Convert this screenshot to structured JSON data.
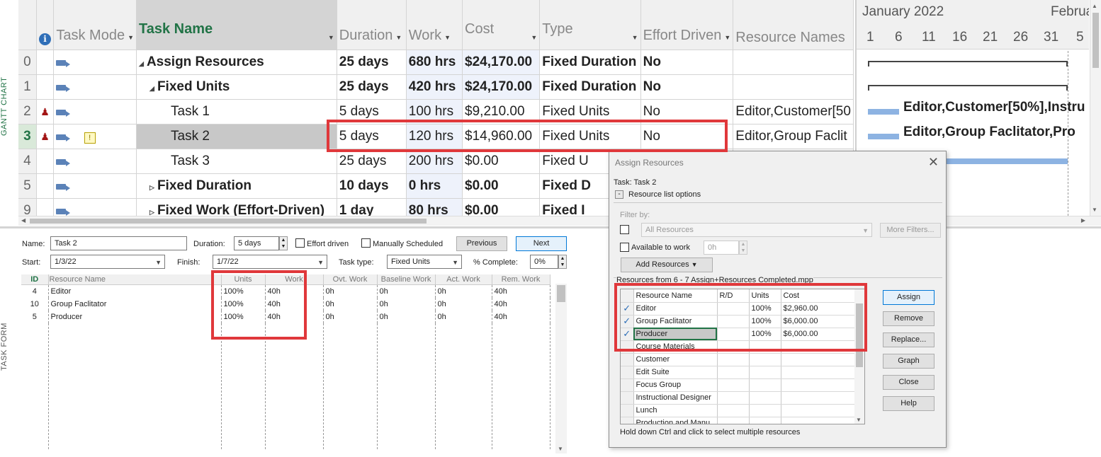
{
  "side_labels": {
    "gantt": "GANTT CHART",
    "form": "TASK FORM"
  },
  "gantt": {
    "headers": {
      "info": "i",
      "task_mode": "Task Mode",
      "task_name": "Task Name",
      "duration": "Duration",
      "work": "Work",
      "cost": "Cost",
      "type": "Type",
      "effort_driven": "Effort Driven",
      "resource_names": "Resource Names"
    },
    "rows": [
      {
        "id": "0",
        "indicator": "",
        "name": "Assign Resources",
        "outline": "◢",
        "duration": "25 days",
        "work": "680 hrs",
        "cost": "$24,170.00",
        "type": "Fixed Duration",
        "effort": "No",
        "resources": ""
      },
      {
        "id": "1",
        "indicator": "",
        "name": "Fixed Units",
        "outline": "◢",
        "duration": "25 days",
        "work": "420 hrs",
        "cost": "$24,170.00",
        "type": "Fixed Duration",
        "effort": "No",
        "resources": ""
      },
      {
        "id": "2",
        "indicator": "person",
        "name": "Task 1",
        "outline": "",
        "duration": "5 days",
        "work": "100 hrs",
        "cost": "$9,210.00",
        "type": "Fixed Units",
        "effort": "No",
        "resources": "Editor,Customer[50"
      },
      {
        "id": "3",
        "indicator": "person",
        "name": "Task 2",
        "outline": "",
        "duration": "5 days",
        "work": "120 hrs",
        "cost": "$14,960.00",
        "type": "Fixed Units",
        "effort": "No",
        "resources": "Editor,Group Faclit"
      },
      {
        "id": "4",
        "indicator": "",
        "name": "Task 3",
        "outline": "",
        "duration": "25 days",
        "work": "200 hrs",
        "cost": "$0.00",
        "type": "Fixed U",
        "effort": "",
        "resources": ""
      },
      {
        "id": "5",
        "indicator": "",
        "name": "Fixed Duration",
        "outline": "▷",
        "duration": "10 days",
        "work": "0 hrs",
        "cost": "$0.00",
        "type": "Fixed D",
        "effort": "",
        "resources": ""
      },
      {
        "id": "9",
        "indicator": "",
        "name": "Fixed Work (Effort-Driven)",
        "outline": "▷",
        "duration": "1 day",
        "work": "80 hrs",
        "cost": "$0.00",
        "type": "Fixed I",
        "effort": "",
        "resources": ""
      }
    ]
  },
  "chart": {
    "month1": "January 2022",
    "month2": "Februa",
    "days": [
      "1",
      "6",
      "11",
      "16",
      "21",
      "26",
      "31",
      "5"
    ],
    "bar_labels": {
      "task1": "Editor,Customer[50%],Instru",
      "task2": "Editor,Group Faclitator,Pro"
    }
  },
  "task_form": {
    "name_label": "Name:",
    "name_value": "Task 2",
    "duration_label": "Duration:",
    "duration_value": "5 days",
    "effort_driven_label": "Effort driven",
    "manually_scheduled_label": "Manually Scheduled",
    "previous_label": "Previous",
    "next_label": "Next",
    "start_label": "Start:",
    "start_value": "1/3/22",
    "finish_label": "Finish:",
    "finish_value": "1/7/22",
    "task_type_label": "Task type:",
    "task_type_value": "Fixed Units",
    "pct_complete_label": "% Complete:",
    "pct_complete_value": "0%",
    "columns": [
      "ID",
      "Resource Name",
      "Units",
      "Work",
      "Ovt. Work",
      "Baseline Work",
      "Act. Work",
      "Rem. Work"
    ],
    "resources": [
      {
        "id": "4",
        "name": "Editor",
        "units": "100%",
        "work": "40h",
        "ovt": "0h",
        "baseline": "0h",
        "act": "0h",
        "rem": "40h"
      },
      {
        "id": "10",
        "name": "Group Faclitator",
        "units": "100%",
        "work": "40h",
        "ovt": "0h",
        "baseline": "0h",
        "act": "0h",
        "rem": "40h"
      },
      {
        "id": "5",
        "name": "Producer",
        "units": "100%",
        "work": "40h",
        "ovt": "0h",
        "baseline": "0h",
        "act": "0h",
        "rem": "40h"
      }
    ]
  },
  "dialog": {
    "title": "Assign Resources",
    "task_label": "Task: Task 2",
    "collapse": "-",
    "list_options": "Resource list options",
    "filter_by": "Filter by:",
    "filter_value": "All Resources",
    "more_filters": "More Filters...",
    "available_label": "Available to work",
    "available_value": "0h",
    "add_resources": "Add Resources",
    "resources_from": "Resources from 6 - 7 Assign+Resources Completed.mpp",
    "columns": [
      "Resource Name",
      "R/D",
      "Units",
      "Cost"
    ],
    "rows": [
      {
        "checked": "✓",
        "name": "Editor",
        "rd": "",
        "units": "100%",
        "cost": "$2,960.00"
      },
      {
        "checked": "✓",
        "name": "Group Faclitator",
        "rd": "",
        "units": "100%",
        "cost": "$6,000.00"
      },
      {
        "checked": "✓",
        "name": "Producer",
        "rd": "",
        "units": "100%",
        "cost": "$6,000.00"
      },
      {
        "checked": "",
        "name": "Course Materials",
        "rd": "",
        "units": "",
        "cost": ""
      },
      {
        "checked": "",
        "name": "Customer",
        "rd": "",
        "units": "",
        "cost": ""
      },
      {
        "checked": "",
        "name": "Edit Suite",
        "rd": "",
        "units": "",
        "cost": ""
      },
      {
        "checked": "",
        "name": "Focus Group",
        "rd": "",
        "units": "",
        "cost": ""
      },
      {
        "checked": "",
        "name": "Instructional Designer",
        "rd": "",
        "units": "",
        "cost": ""
      },
      {
        "checked": "",
        "name": "Lunch",
        "rd": "",
        "units": "",
        "cost": ""
      },
      {
        "checked": "",
        "name": "Production and Manu",
        "rd": "",
        "units": "",
        "cost": ""
      }
    ],
    "buttons": {
      "assign": "Assign",
      "remove": "Remove",
      "replace": "Replace...",
      "graph": "Graph",
      "close": "Close",
      "help": "Help"
    },
    "hint": "Hold down Ctrl and click to select multiple resources"
  },
  "colors": {
    "highlight": "#e0383b",
    "accent_green": "#217346",
    "bar_blue": "#8db3e2"
  }
}
